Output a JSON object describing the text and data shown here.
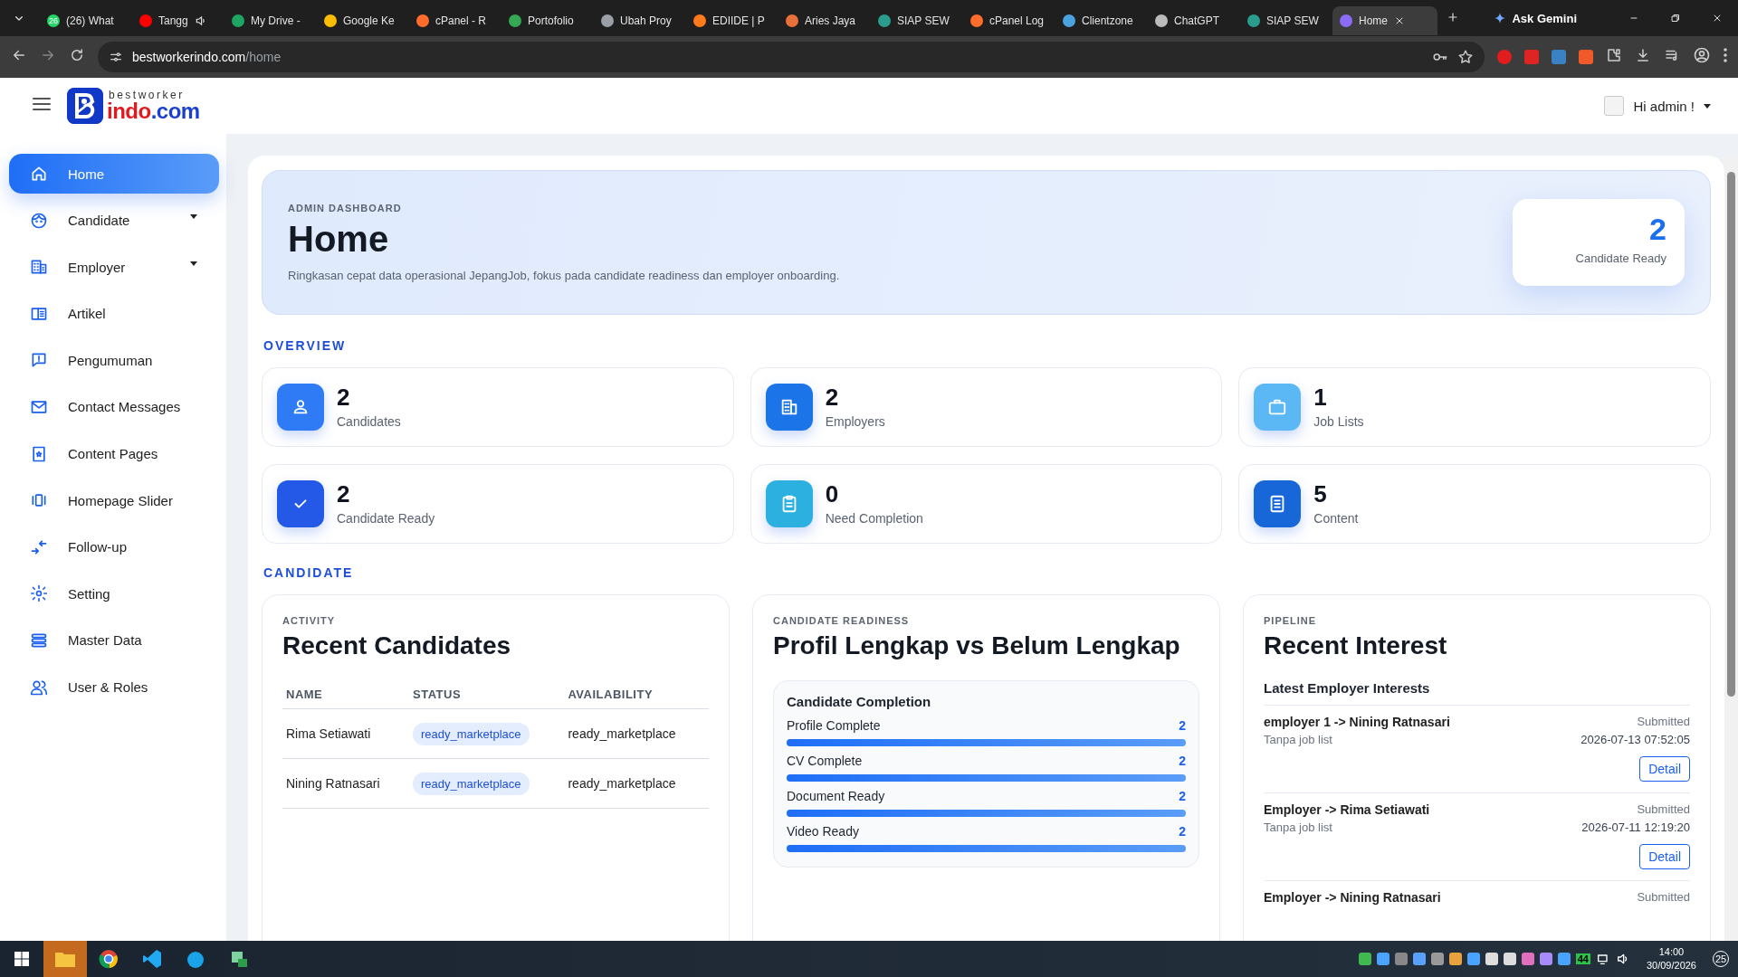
{
  "browser": {
    "tabs": [
      {
        "title": "(26) What",
        "selected": false,
        "audio": false,
        "badge": "26"
      },
      {
        "title": "Tangg",
        "selected": false,
        "audio": true
      },
      {
        "title": "My Drive -",
        "selected": false,
        "audio": false
      },
      {
        "title": "Google Ke",
        "selected": false,
        "audio": false
      },
      {
        "title": "cPanel - R",
        "selected": false,
        "audio": false
      },
      {
        "title": "Portofolio",
        "selected": false,
        "audio": false
      },
      {
        "title": "Ubah Proy",
        "selected": false,
        "audio": false
      },
      {
        "title": "EDIIDE | P",
        "selected": false,
        "audio": false
      },
      {
        "title": "Aries Jaya",
        "selected": false,
        "audio": false
      },
      {
        "title": "SIAP SEW",
        "selected": false,
        "audio": false
      },
      {
        "title": "cPanel Log",
        "selected": false,
        "audio": false
      },
      {
        "title": "Clientzone",
        "selected": false,
        "audio": false
      },
      {
        "title": "ChatGPT",
        "selected": false,
        "audio": false
      },
      {
        "title": "SIAP SEW",
        "selected": false,
        "audio": false
      },
      {
        "title": "Home",
        "selected": true,
        "audio": false
      }
    ],
    "gemini": "Ask Gemini",
    "url_host": "bestworkerindo.com",
    "url_path": "/home"
  },
  "header": {
    "logo": {
      "top": "bestworker",
      "main": "indo",
      "suffix": ".com"
    },
    "user": "Hi admin !"
  },
  "sidebar": {
    "items": [
      {
        "label": "Home",
        "selected": true,
        "submenu": false
      },
      {
        "label": "Candidate",
        "selected": false,
        "submenu": true
      },
      {
        "label": "Employer",
        "selected": false,
        "submenu": true
      },
      {
        "label": "Artikel",
        "selected": false,
        "submenu": false
      },
      {
        "label": "Pengumuman",
        "selected": false,
        "submenu": false
      },
      {
        "label": "Contact Messages",
        "selected": false,
        "submenu": false
      },
      {
        "label": "Content Pages",
        "selected": false,
        "submenu": false
      },
      {
        "label": "Homepage Slider",
        "selected": false,
        "submenu": false
      },
      {
        "label": "Follow-up",
        "selected": false,
        "submenu": false
      },
      {
        "label": "Setting",
        "selected": false,
        "submenu": false
      },
      {
        "label": "Master Data",
        "selected": false,
        "submenu": false
      },
      {
        "label": "User & Roles",
        "selected": false,
        "submenu": false
      }
    ]
  },
  "hero": {
    "kicker": "ADMIN DASHBOARD",
    "title": "Home",
    "description": "Ringkasan cepat data operasional JepangJob, fokus pada candidate readiness dan employer onboarding.",
    "stat_value": "2",
    "stat_label": "Candidate Ready"
  },
  "overview": {
    "heading": "OVERVIEW",
    "cards": [
      {
        "value": "2",
        "label": "Candidates",
        "color": "#2f7bf6"
      },
      {
        "value": "2",
        "label": "Employers",
        "color": "#1c74e9"
      },
      {
        "value": "1",
        "label": "Job Lists",
        "color": "#5bb8f5"
      },
      {
        "value": "2",
        "label": "Candidate Ready",
        "color": "#2458e6"
      },
      {
        "value": "0",
        "label": "Need Completion",
        "color": "#2bb0e0"
      },
      {
        "value": "5",
        "label": "Content",
        "color": "#1767d8"
      }
    ]
  },
  "candidate": {
    "heading": "CANDIDATE",
    "recent": {
      "kicker": "ACTIVITY",
      "title": "Recent Candidates",
      "columns": [
        "NAME",
        "STATUS",
        "AVAILABILITY"
      ],
      "rows": [
        [
          "Rima Setiawati",
          "ready_marketplace",
          "ready_marketplace"
        ],
        [
          "Nining Ratnasari",
          "ready_marketplace",
          "ready_marketplace"
        ]
      ]
    },
    "readiness": {
      "kicker": "CANDIDATE READINESS",
      "title": "Profil Lengkap vs Belum Lengkap",
      "box_title": "Candidate Completion",
      "metrics": [
        {
          "label": "Profile Complete",
          "value": "2",
          "level": 1
        },
        {
          "label": "CV Complete",
          "value": "2",
          "level": 1
        },
        {
          "label": "Document Ready",
          "value": "2",
          "level": 1
        },
        {
          "label": "Video Ready",
          "value": "2",
          "level": 1
        }
      ]
    },
    "pipeline": {
      "kicker": "PIPELINE",
      "title": "Recent Interest",
      "subtitle": "Latest Employer Interests",
      "items": [
        {
          "title": "employer 1 -> Nining Ratnasari",
          "subtitle": "Tanpa job list",
          "status": "Submitted",
          "date": "2026-07-13 07:52:05",
          "button": "Detail"
        },
        {
          "title": "Employer -> Rima Setiawati",
          "subtitle": "Tanpa job list",
          "status": "Submitted",
          "date": "2026-07-11 12:19:20",
          "button": "Detail"
        },
        {
          "title": "Employer -> Nining Ratnasari",
          "status": "Submitted"
        }
      ]
    }
  },
  "taskbar": {
    "tray_badge": "44",
    "time": "14:00",
    "date": "30/09/2026",
    "notifications": "25"
  }
}
